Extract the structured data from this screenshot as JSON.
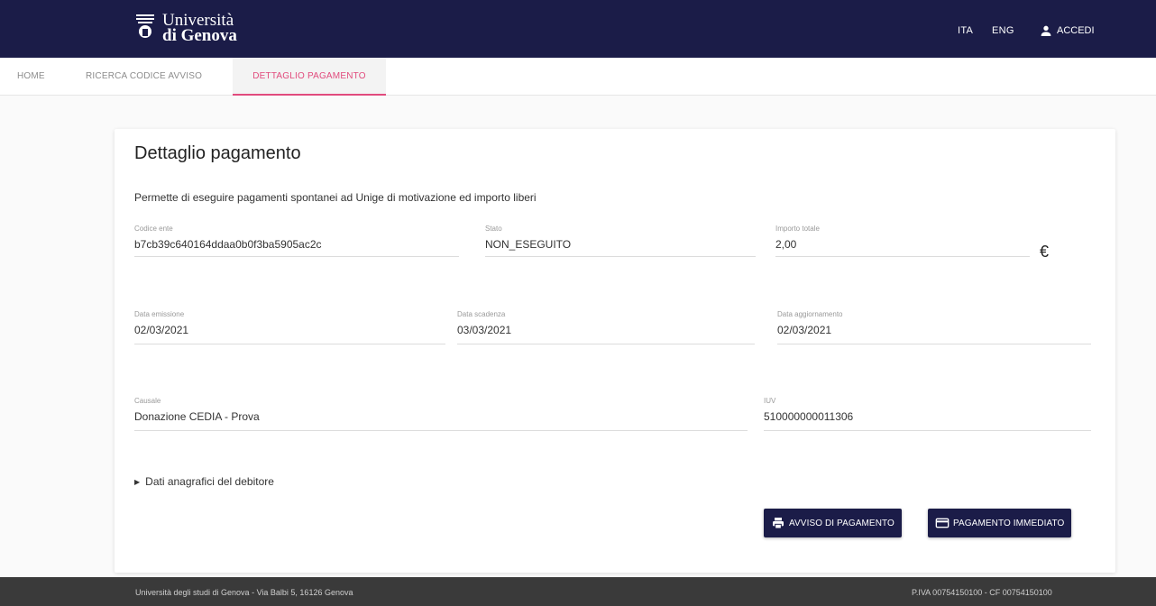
{
  "header": {
    "logo_line1": "Università",
    "logo_line2": "di Genova",
    "lang_ita": "ITA",
    "lang_eng": "ENG",
    "login_label": "ACCEDI"
  },
  "nav": {
    "tabs": [
      {
        "label": "HOME"
      },
      {
        "label": "RICERCA CODICE AVVISO"
      },
      {
        "label": "DETTAGLIO PAGAMENTO"
      }
    ]
  },
  "detail": {
    "title": "Dettaglio pagamento",
    "description": "Permette di eseguire pagamenti spontanei ad Unige di motivazione ed importo liberi",
    "codice_ente": {
      "label": "Codice ente",
      "value": "b7cb39c640164ddaa0b0f3ba5905ac2c"
    },
    "stato": {
      "label": "Stato",
      "value": "NON_ESEGUITO"
    },
    "importo": {
      "label": "Importo totale",
      "value": "2,00"
    },
    "currency": "€",
    "data_emissione": {
      "label": "Data emissione",
      "value": "02/03/2021"
    },
    "data_scadenza": {
      "label": "Data scadenza",
      "value": "03/03/2021"
    },
    "data_aggiornamento": {
      "label": "Data aggiornamento",
      "value": "02/03/2021"
    },
    "causale": {
      "label": "Causale",
      "value": "Donazione CEDIA - Prova"
    },
    "iuv": {
      "label": "IUV",
      "value": "510000000011306"
    },
    "debtor_toggle": "Dati anagrafici del debitore",
    "btn_avviso": "AVVISO DI PAGAMENTO",
    "btn_pagamento": "PAGAMENTO IMMEDIATO"
  },
  "footer": {
    "left": "Università degli studi di Genova - Via Balbi 5, 16126 Genova",
    "right": "P.IVA 00754150100 - CF 00754150100"
  },
  "colors": {
    "primary": "#1b1c48",
    "accent": "#e14b7d",
    "footer": "#3a3a3a"
  }
}
